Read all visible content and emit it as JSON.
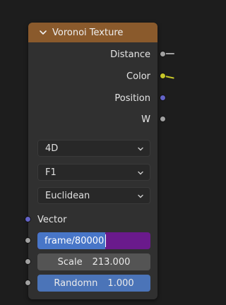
{
  "node": {
    "title": "Voronoi Texture",
    "header_color": "#8a5a2c",
    "outputs": [
      {
        "label": "Distance",
        "socket_color": "#a1a1a1"
      },
      {
        "label": "Color",
        "socket_color": "#c7c729"
      },
      {
        "label": "Position",
        "socket_color": "#6363c7"
      },
      {
        "label": "W",
        "socket_color": "#a1a1a1"
      }
    ],
    "dropdowns": [
      {
        "value": "4D"
      },
      {
        "value": "F1"
      },
      {
        "value": "Euclidean"
      }
    ],
    "inputs": {
      "vector": {
        "label": "Vector",
        "socket_color": "#6363c7"
      },
      "expression": {
        "value": "frame/80000",
        "socket_color": "#a1a1a1"
      },
      "scale": {
        "label": "Scale",
        "value": "213.000",
        "socket_color": "#a1a1a1"
      },
      "randomness": {
        "label": "Randomn",
        "value": "1.000",
        "socket_color": "#a1a1a1"
      }
    }
  },
  "icons": {
    "collapse": "chevron-down-icon",
    "dropdown": "caret-down-icon"
  }
}
